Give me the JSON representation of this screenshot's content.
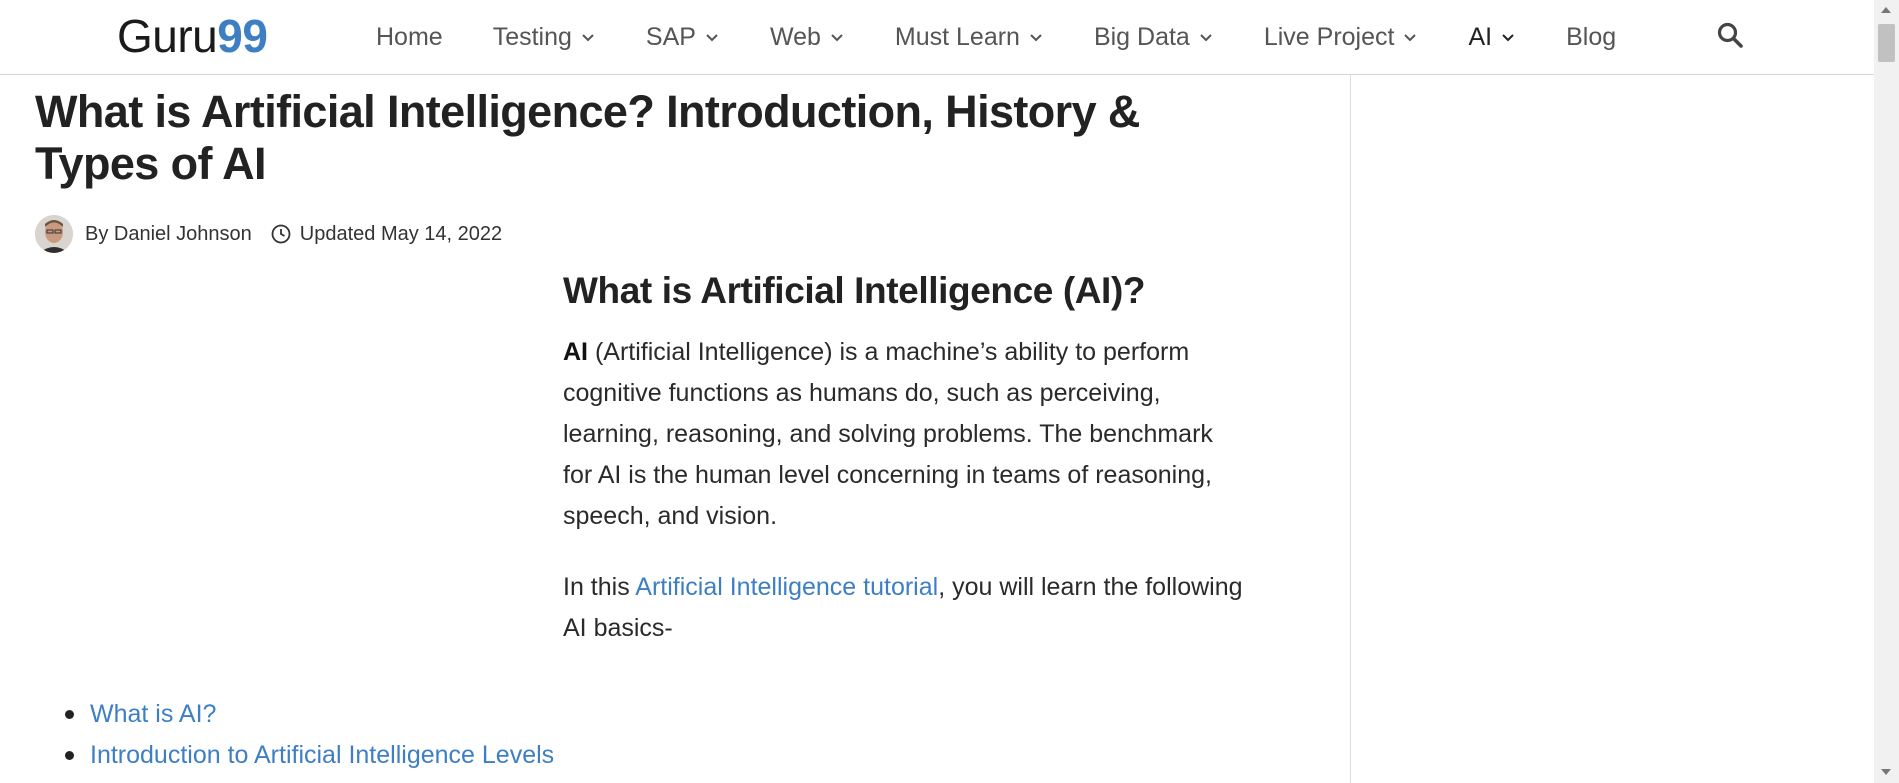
{
  "header": {
    "logo_part1": "Guru",
    "logo_part2": "99",
    "nav": [
      {
        "label": "Home",
        "dropdown": false
      },
      {
        "label": "Testing",
        "dropdown": true
      },
      {
        "label": "SAP",
        "dropdown": true
      },
      {
        "label": "Web",
        "dropdown": true
      },
      {
        "label": "Must Learn",
        "dropdown": true
      },
      {
        "label": "Big Data",
        "dropdown": true
      },
      {
        "label": "Live Project",
        "dropdown": true
      },
      {
        "label": "AI",
        "dropdown": true
      },
      {
        "label": "Blog",
        "dropdown": false
      }
    ],
    "search_icon": "search-icon"
  },
  "article": {
    "title": "What is Artificial Intelligence? Introduction, History & Types of AI",
    "author_prefix": "By ",
    "author": "Daniel Johnson",
    "updated": "Updated May 14, 2022",
    "heading": "What is Artificial Intelligence (AI)?",
    "para1_bold": "AI",
    "para1_text": " (Artificial Intelligence) is a machine’s ability to perform cognitive functions as humans do, such as perceiving, learning, reasoning, and solving problems. The benchmark for AI is the human level concerning in teams of reasoning, speech, and vision.",
    "para2_before": "In this ",
    "para2_link": "Artificial Intelligence tutorial",
    "para2_after": ", you will learn the following AI basics-",
    "toc": [
      "What is AI?",
      "Introduction to Artificial Intelligence Levels"
    ]
  },
  "colors": {
    "accent": "#3e7fc4",
    "text": "#222222",
    "nav_text": "#555555",
    "divider": "#d6d6d6"
  }
}
